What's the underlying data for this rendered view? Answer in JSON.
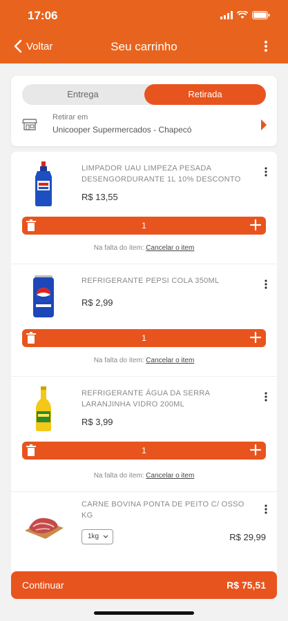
{
  "status": {
    "time": "17:06"
  },
  "nav": {
    "back_label": "Voltar",
    "title": "Seu carrinho"
  },
  "delivery": {
    "option_delivery": "Entrega",
    "option_pickup": "Retirada",
    "selected": "Retirada",
    "pickup_label": "Retirar em",
    "store_name": "Unicooper Supermercados - Chapecó"
  },
  "items": [
    {
      "name": "LIMPADOR UAU LIMPEZA PESADA DESENGORDURANTE 1L 10% DESCONTO",
      "price": "R$ 13,55",
      "quantity": "1",
      "missing_label": "Na falta do item:",
      "cancel_label": "Cancelar o item"
    },
    {
      "name": "REFRIGERANTE PEPSI COLA 350ML",
      "price": "R$ 2,99",
      "quantity": "1",
      "missing_label": "Na falta do item:",
      "cancel_label": "Cancelar o item"
    },
    {
      "name": "REFRIGERANTE ÁGUA DA SERRA LARANJINHA VIDRO 200ML",
      "price": "R$ 3,99",
      "quantity": "1",
      "missing_label": "Na falta do item:",
      "cancel_label": "Cancelar o item"
    },
    {
      "name": "CARNE BOVINA PONTA DE PEITO C/ OSSO KG",
      "price": "R$ 29,99",
      "unit": "1kg"
    }
  ],
  "footer": {
    "continue_label": "Continuar",
    "total": "R$ 75,51"
  },
  "colors": {
    "accent": "#e8541e",
    "header": "#e8641e"
  }
}
